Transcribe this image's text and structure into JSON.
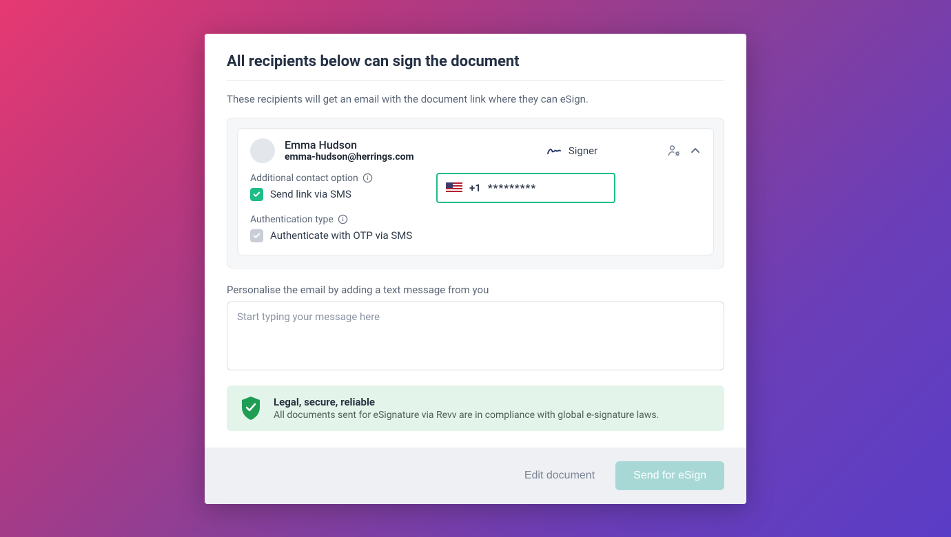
{
  "title": "All recipients below can sign the document",
  "subtitle": "These recipients will get an email with the document link where they can eSign.",
  "recipient": {
    "name": "Emma Hudson",
    "email": "emma-hudson@herrings.com",
    "role": "Signer",
    "additional_contact_label": "Additional contact option",
    "sms_link_label": "Send link via SMS",
    "sms_link_checked": "true",
    "phone_country_code": "+1",
    "phone_masked": "*********",
    "auth_type_label": "Authentication type",
    "otp_label": "Authenticate with OTP via SMS",
    "otp_checked": "false"
  },
  "personalise_label": "Personalise the email by adding a text message from you",
  "message_placeholder": "Start typing your message here",
  "legal": {
    "title": "Legal, secure, reliable",
    "subtitle": "All documents sent for eSignature via Revv are in compliance with global e-signature laws."
  },
  "footer": {
    "edit_label": "Edit document",
    "send_label": "Send for eSign"
  }
}
